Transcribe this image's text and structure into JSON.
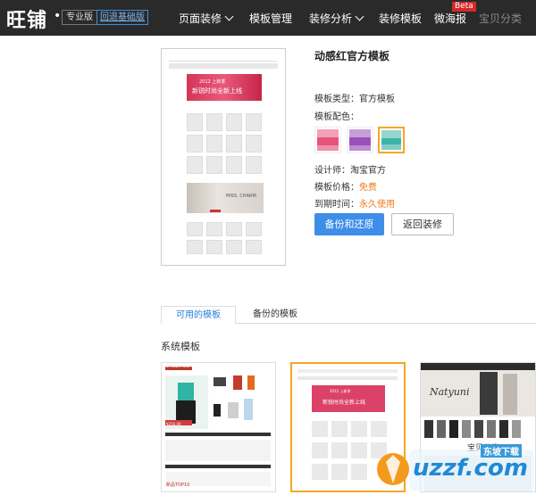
{
  "nav": {
    "logo": "旺铺",
    "logo_dot": "•",
    "edition_badge": "专业版",
    "return_link": "回退基础版",
    "items": [
      {
        "label": "页面装修",
        "has_dropdown": true
      },
      {
        "label": "模板管理",
        "has_dropdown": false
      },
      {
        "label": "装修分析",
        "has_dropdown": true
      },
      {
        "label": "装修模板",
        "has_dropdown": false
      },
      {
        "label": "微海报",
        "has_dropdown": false,
        "badge": "Beta"
      },
      {
        "label": "宝贝分类",
        "has_dropdown": false
      }
    ]
  },
  "preview": {
    "banner_line1": "2012 上新季",
    "banner_line2": "新锐时尚全新上线",
    "fashion_text": "MISS. CHARM"
  },
  "template": {
    "title": "动感红官方模板",
    "type_label": "模板类型：",
    "type_value": "官方模板",
    "color_label": "模板配色：",
    "swatch_colors": [
      "#e8547a",
      "#9b4fb8",
      "#3cb3a6"
    ],
    "designer_label": "设计师：",
    "designer_value": "淘宝官方",
    "price_label": "模板价格：",
    "price_value": "免费",
    "expiry_label": "到期时间：",
    "expiry_value": "永久使用",
    "backup_button": "备份和还原",
    "return_button": "返回装修"
  },
  "tabs": {
    "available": "可用的模板",
    "backup": "备份的模板"
  },
  "section": {
    "system_templates": "系统模板"
  },
  "thumbs": {
    "t1_header": "SMILEFACE 微笑",
    "t1_price": "¥256.00",
    "t1_footer": "新品TOP10",
    "t3_brand": "Natyuni",
    "t3_heading": "宝贝分类"
  },
  "watermark": {
    "brand": "uzzf.com",
    "cn": "东坡下载"
  },
  "colors": {
    "accent_blue": "#3e8ee8",
    "orange": "#f07a1c",
    "selected_border": "#f5a623",
    "nav_bg": "#2a2a2a"
  }
}
